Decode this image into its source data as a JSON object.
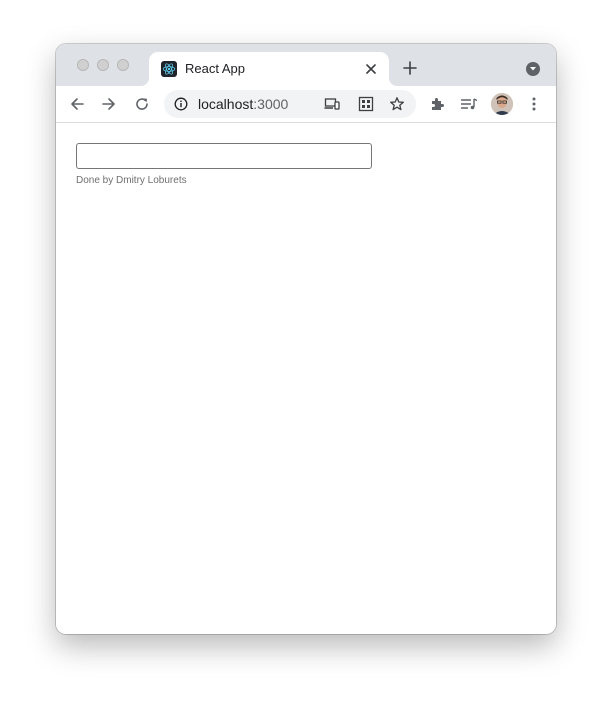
{
  "browser": {
    "tab": {
      "title": "React App",
      "favicon": "react-logo-icon"
    },
    "address_bar": {
      "host": "localhost",
      "port": ":3000"
    },
    "icons": {
      "back": "arrow-left-icon",
      "forward": "arrow-right-icon",
      "reload": "reload-icon",
      "info": "info-icon",
      "cast": "cast-icon",
      "qr": "qr-code-icon",
      "bookmark": "star-icon",
      "extensions": "puzzle-icon",
      "media": "media-queue-icon",
      "menu": "kebab-menu-icon"
    },
    "colors": {
      "tabstrip": "#dee1e6",
      "omnibox": "#f1f3f4",
      "react_logo": "#61dafb"
    }
  },
  "page": {
    "input": {
      "value": "",
      "placeholder": ""
    },
    "credit": "Done by Dmitry Loburets"
  }
}
